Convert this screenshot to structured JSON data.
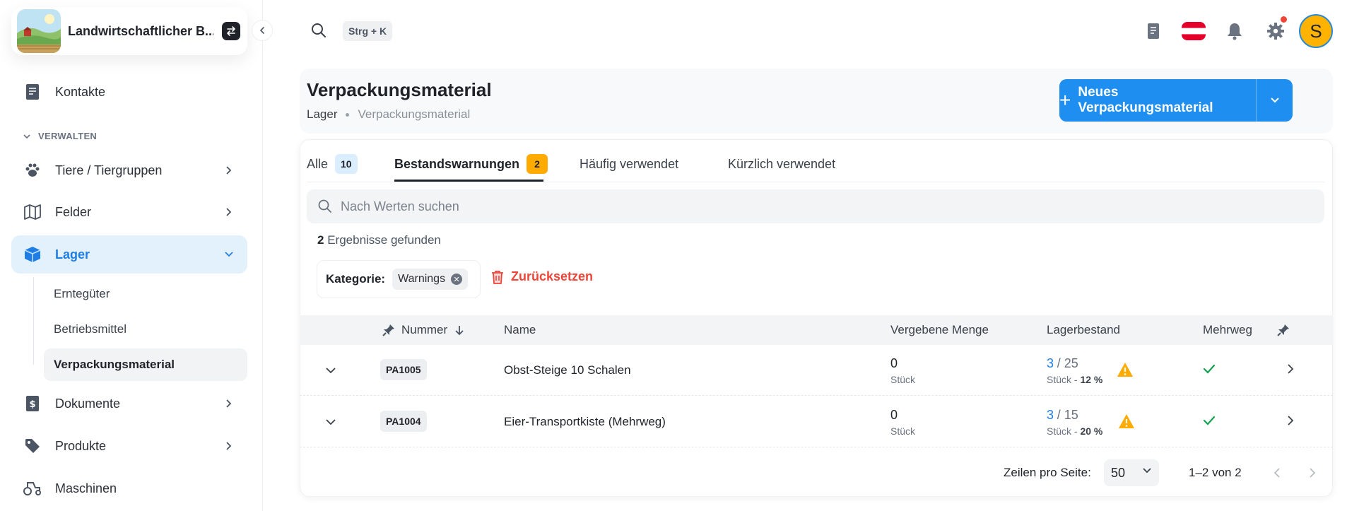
{
  "app": {
    "brand_name": "Landwirtschaftlicher B...",
    "search_shortcut": "Strg + K"
  },
  "sidebar": {
    "top_item": "Kontakte",
    "section_title": "VERWALTEN",
    "items": [
      {
        "label": "Tiere / Tiergruppen",
        "icon": "paw-icon"
      },
      {
        "label": "Felder",
        "icon": "map-icon"
      },
      {
        "label": "Lager",
        "icon": "cube-icon",
        "active": true
      },
      {
        "label": "Dokumente",
        "icon": "dollar-document-icon"
      },
      {
        "label": "Produkte",
        "icon": "tag-icon"
      },
      {
        "label": "Maschinen",
        "icon": "tractor-icon"
      }
    ],
    "sub_items": [
      "Erntegüter",
      "Betriebsmittel",
      "Verpackungsmaterial"
    ],
    "active_sub": "Verpackungsmaterial"
  },
  "page": {
    "title": "Verpackungsmaterial",
    "breadcrumb": [
      "Lager",
      "Verpackungsmaterial"
    ],
    "primary_button": "Neues Verpackungsmaterial"
  },
  "tabs": [
    {
      "label": "Alle",
      "count": "10"
    },
    {
      "label": "Bestandswarnungen",
      "count": "2",
      "active": true
    },
    {
      "label": "Häufig verwendet"
    },
    {
      "label": "Kürzlich verwendet"
    }
  ],
  "search": {
    "placeholder": "Nach Werten suchen"
  },
  "results": {
    "count": "2",
    "text": "Ergebnisse gefunden"
  },
  "filter": {
    "key": "Kategorie:",
    "value": "Warnings",
    "reset_label": "Zurücksetzen"
  },
  "table": {
    "headers": {
      "number": "Nummer",
      "name": "Name",
      "assigned": "Vergebene Menge",
      "stock": "Lagerbestand",
      "reusable": "Mehrweg"
    },
    "rows": [
      {
        "code": "PA1005",
        "name": "Obst-Steige 10 Schalen",
        "assigned": "0",
        "assigned_unit": "Stück",
        "stock": "3",
        "stock_total": "/ 25",
        "stock_unit": "Stück",
        "stock_pct": "12 %",
        "reusable": true
      },
      {
        "code": "PA1004",
        "name": "Eier-Transportkiste (Mehrweg)",
        "assigned": "0",
        "assigned_unit": "Stück",
        "stock": "3",
        "stock_total": "/ 15",
        "stock_unit": "Stück",
        "stock_pct": "20 %",
        "reusable": true
      }
    ]
  },
  "pagination": {
    "rows_label": "Zeilen pro Seite:",
    "rows_value": "50",
    "range": "1–2 von 2"
  },
  "colors": {
    "accent": "#1f8ef1",
    "active_bg": "#e3f1fd",
    "warning": "#ffab00",
    "danger": "#f04438",
    "success": "#12a150"
  }
}
